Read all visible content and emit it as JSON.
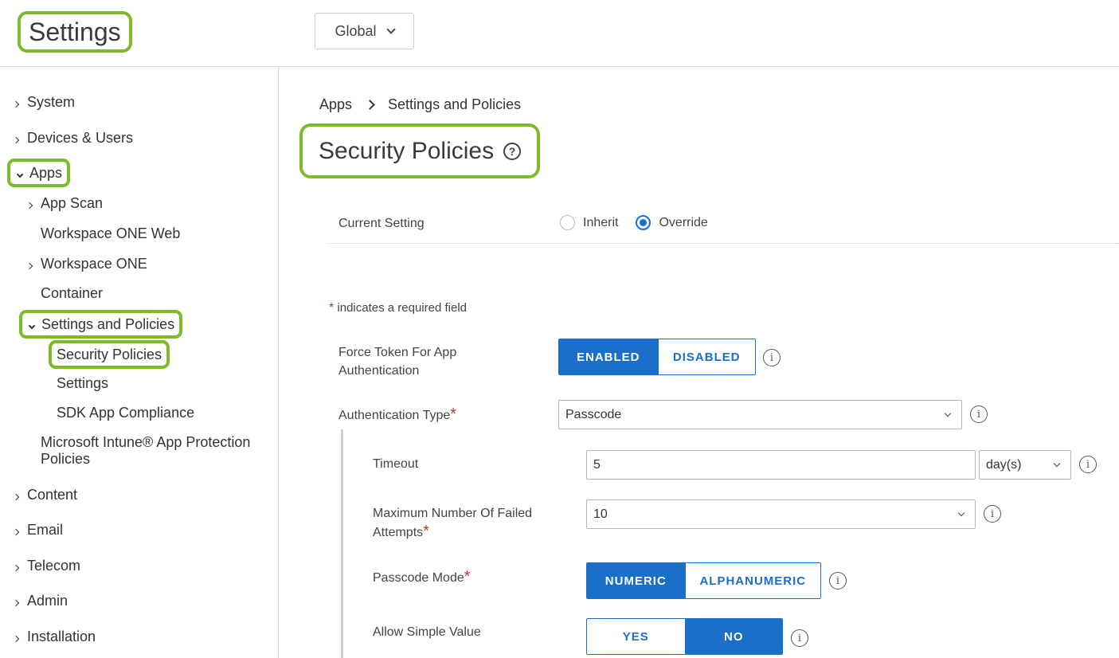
{
  "header": {
    "title": "Settings",
    "scope": "Global"
  },
  "sidebar": {
    "items": [
      {
        "label": "System"
      },
      {
        "label": "Devices & Users"
      },
      {
        "label": "Apps"
      },
      {
        "label": "App Scan"
      },
      {
        "label": "Workspace ONE Web"
      },
      {
        "label": "Workspace ONE"
      },
      {
        "label": "Container"
      },
      {
        "label": "Settings and Policies"
      },
      {
        "label": "Security Policies"
      },
      {
        "label": "Settings"
      },
      {
        "label": "SDK App Compliance"
      },
      {
        "label": "Microsoft Intune® App Protection Policies"
      },
      {
        "label": "Content"
      },
      {
        "label": "Email"
      },
      {
        "label": "Telecom"
      },
      {
        "label": "Admin"
      },
      {
        "label": "Installation"
      }
    ]
  },
  "breadcrumb": {
    "root": "Apps",
    "current": "Settings and Policies"
  },
  "page": {
    "title": "Security Policies",
    "help_glyph": "?"
  },
  "current_setting": {
    "label": "Current Setting",
    "options": [
      "Inherit",
      "Override"
    ],
    "selected": "Override"
  },
  "required_note": {
    "star": "*",
    "text": "indicates a required field"
  },
  "form": {
    "force_token": {
      "label": "Force Token For App Authentication",
      "options": [
        "ENABLED",
        "DISABLED"
      ],
      "selected": "ENABLED"
    },
    "auth_type": {
      "label": "Authentication Type",
      "value": "Passcode"
    },
    "timeout": {
      "label": "Timeout",
      "value": "5",
      "unit": "day(s)"
    },
    "max_failed": {
      "label": "Maximum Number Of Failed Attempts",
      "value": "10"
    },
    "passcode_mode": {
      "label": "Passcode Mode",
      "options": [
        "NUMERIC",
        "ALPHANUMERIC"
      ],
      "selected": "NUMERIC"
    },
    "simple_value": {
      "label": "Allow Simple Value",
      "options": [
        "YES",
        "NO"
      ],
      "selected": "NO"
    }
  },
  "icons": {
    "info": "i",
    "required_star": "*"
  },
  "colors": {
    "accent": "#1a6fc9",
    "highlight": "#7dbb2a",
    "required": "#c0392b"
  }
}
